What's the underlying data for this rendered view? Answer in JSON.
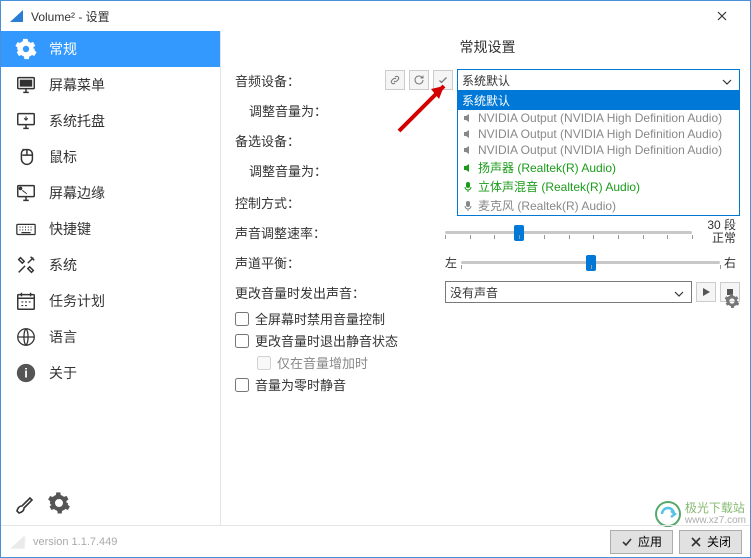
{
  "window": {
    "title": "Volume² - 设置"
  },
  "sidebar": {
    "items": [
      {
        "label": "常规"
      },
      {
        "label": "屏幕菜单"
      },
      {
        "label": "系统托盘"
      },
      {
        "label": "鼠标"
      },
      {
        "label": "屏幕边缘"
      },
      {
        "label": "快捷键"
      },
      {
        "label": "系统"
      },
      {
        "label": "任务计划"
      },
      {
        "label": "语言"
      },
      {
        "label": "关于"
      }
    ]
  },
  "content": {
    "title": "常规设置",
    "labels": {
      "audio_device": "音频设备：",
      "adjust_volume_for": "调整音量为：",
      "backup_device": "备选设备：",
      "adjust_volume_for2": "调整音量为：",
      "control_method": "控制方式：",
      "volume_speed": "声音调整速率：",
      "balance": "声道平衡：",
      "change_sound": "更改音量时发出声音："
    },
    "audio_device": {
      "selected": "系统默认",
      "options": [
        {
          "text": "系统默认",
          "style": "highlight"
        },
        {
          "text": "NVIDIA Output (NVIDIA High Definition Audio)",
          "style": "gray"
        },
        {
          "text": "NVIDIA Output (NVIDIA High Definition Audio)",
          "style": "gray"
        },
        {
          "text": "NVIDIA Output (NVIDIA High Definition Audio)",
          "style": "gray"
        },
        {
          "text": "扬声器 (Realtek(R) Audio)",
          "style": "green"
        },
        {
          "text": "立体声混音 (Realtek(R) Audio)",
          "style": "green"
        },
        {
          "text": "麦克风 (Realtek(R) Audio)",
          "style": "gray"
        }
      ]
    },
    "speed": {
      "value_text": "30 段",
      "balance_normal": "正常"
    },
    "balance": {
      "left": "左",
      "right": "右"
    },
    "sound_select": {
      "selected": "没有声音"
    },
    "checkboxes": {
      "fullscreen": "全屏幕时禁用音量控制",
      "exit_mute": "更改音量时退出静音状态",
      "only_increase": "仅在音量增加时",
      "zero_mute": "音量为零时静音"
    }
  },
  "footer": {
    "version_prefix": "version ",
    "version": "1.1.7.449",
    "apply": "应用",
    "close": "关闭"
  },
  "watermark": {
    "line1": "极光下载站",
    "line2": "www.xz7.com"
  }
}
